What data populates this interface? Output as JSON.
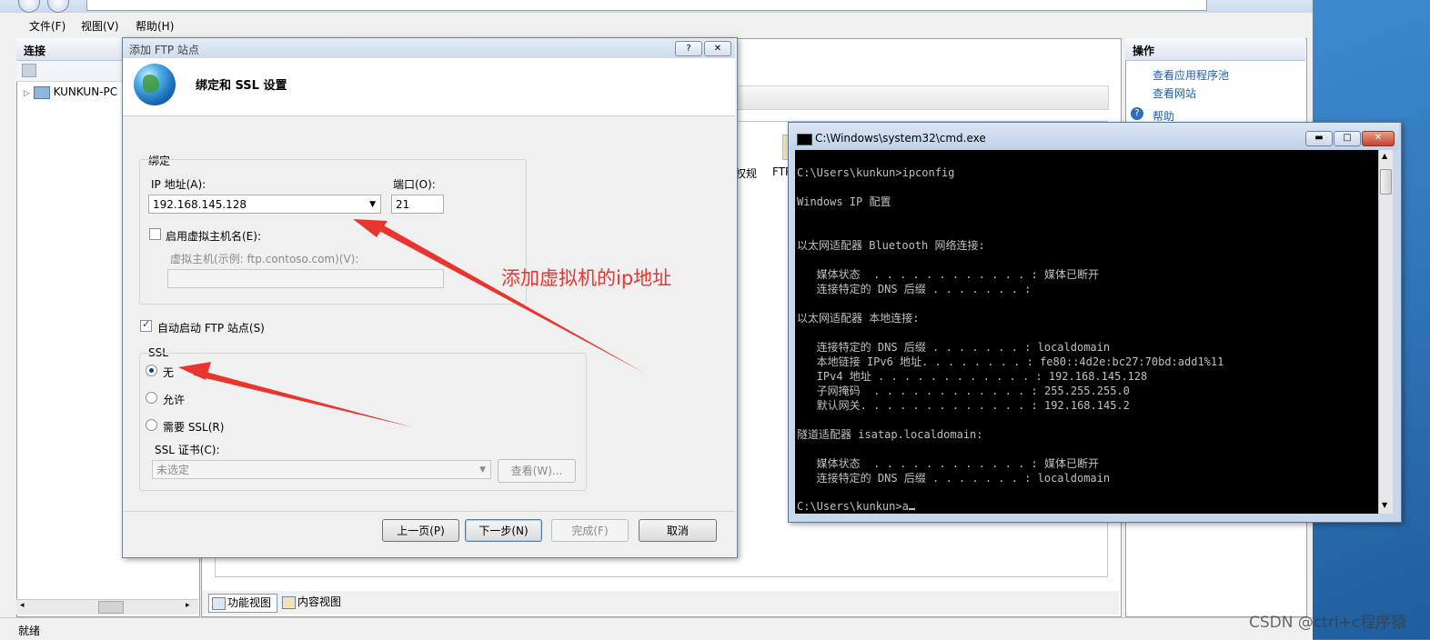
{
  "menu": {
    "file": "文件(F)",
    "view": "视图(V)",
    "help": "帮助(H)"
  },
  "connections": {
    "header": "连接",
    "tree_root": "KUNKUN-PC"
  },
  "actions": {
    "header": "操作",
    "items": [
      "查看应用程序池",
      "查看网站",
      "帮助"
    ]
  },
  "center": {
    "partial_labels": [
      "权规",
      "FTP"
    ],
    "views": [
      "功能视图",
      "内容视图"
    ]
  },
  "status_text": "就绪",
  "dialog": {
    "title": "添加 FTP 站点",
    "help_btn": "?",
    "close_btn": "✕",
    "heading": "绑定和 SSL 设置",
    "binding": {
      "group_label": "绑定",
      "ip_label": "IP 地址(A):",
      "ip_value": "192.168.145.128",
      "port_label": "端口(O):",
      "port_value": "21",
      "enable_vhost_label": "启用虚拟主机名(E):",
      "enable_vhost_checked": false,
      "vhost_label": "虚拟主机(示例: ftp.contoso.com)(V):",
      "vhost_value": ""
    },
    "autostart": {
      "label": "自动启动 FTP 站点(S)",
      "checked": true
    },
    "ssl": {
      "group_label": "SSL",
      "options": [
        "无",
        "允许",
        "需要 SSL(R)"
      ],
      "selected": "无",
      "cert_label": "SSL 证书(C):",
      "cert_value": "未选定",
      "view_btn": "查看(W)..."
    },
    "buttons": {
      "prev": "上一页(P)",
      "next": "下一步(N)",
      "finish": "完成(F)",
      "cancel": "取消"
    }
  },
  "annotation": "添加虚拟机的ip地址",
  "cmd": {
    "title": "C:\\Windows\\system32\\cmd.exe",
    "lines": [
      "C:\\Users\\kunkun>ipconfig",
      "",
      "Windows IP 配置",
      "",
      "",
      "以太网适配器 Bluetooth 网络连接:",
      "",
      "   媒体状态  . . . . . . . . . . . . : 媒体已断开",
      "   连接特定的 DNS 后缀 . . . . . . . :",
      "",
      "以太网适配器 本地连接:",
      "",
      "   连接特定的 DNS 后缀 . . . . . . . : localdomain",
      "   本地链接 IPv6 地址. . . . . . . . : fe80::4d2e:bc27:70bd:add1%11",
      "   IPv4 地址 . . . . . . . . . . . . : 192.168.145.128",
      "   子网掩码  . . . . . . . . . . . . : 255.255.255.0",
      "   默认网关. . . . . . . . . . . . . : 192.168.145.2",
      "",
      "隧道适配器 isatap.localdomain:",
      "",
      "   媒体状态  . . . . . . . . . . . . : 媒体已断开",
      "   连接特定的 DNS 后缀 . . . . . . . : localdomain",
      "",
      "C:\\Users\\kunkun>a"
    ]
  },
  "watermark": "CSDN @ctrl+c程序猿",
  "colors": {
    "annotation": "#e8352f",
    "link": "#1f5fae",
    "console_bg": "#000000",
    "console_fg": "#c0c0c0"
  }
}
